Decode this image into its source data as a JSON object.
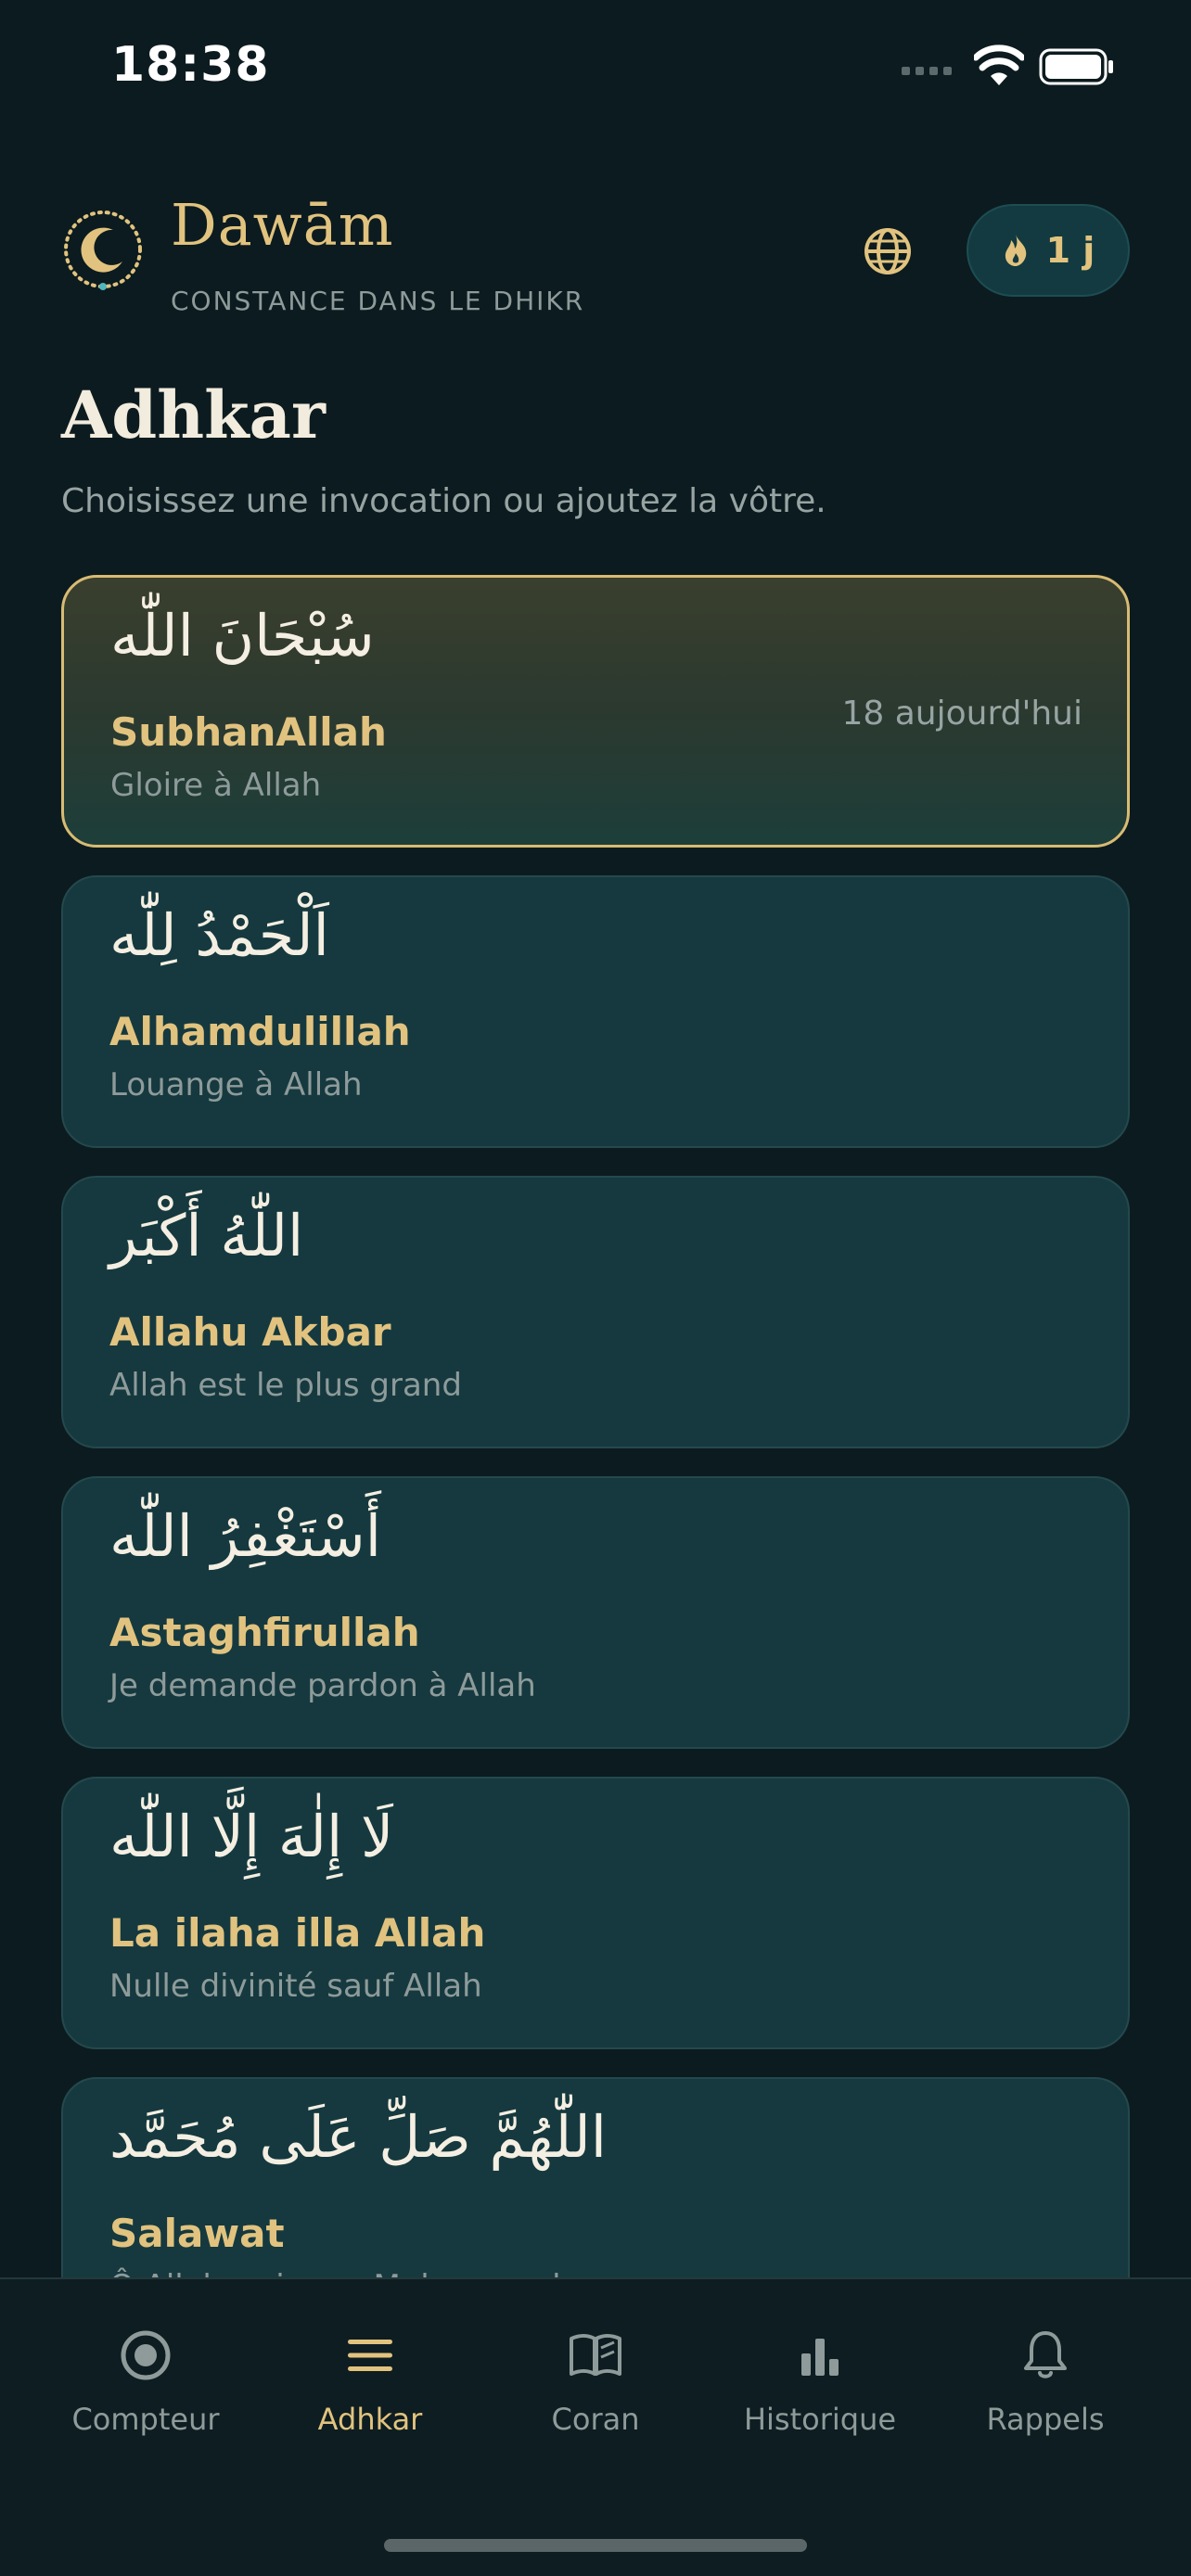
{
  "status_bar": {
    "time": "18:38"
  },
  "header": {
    "app_name": "Dawām",
    "tagline": "CONSTANCE DANS LE DHIKR",
    "language_icon": "globe-icon",
    "streak": {
      "icon": "flame-icon",
      "label": "1 j"
    }
  },
  "page": {
    "title": "Adhkar",
    "description": "Choisissez une invocation ou ajoutez la vôtre."
  },
  "adhkar": [
    {
      "arabic": "سُبْحَانَ اللّٰه",
      "name": "SubhanAllah",
      "translation": "Gloire à Allah",
      "count": "18 aujourd'hui",
      "selected": true
    },
    {
      "arabic": "اَلْحَمْدُ لِلّٰه",
      "name": "Alhamdulillah",
      "translation": "Louange à Allah",
      "count": "",
      "selected": false
    },
    {
      "arabic": "اللّٰهُ أَكْبَر",
      "name": "Allahu Akbar",
      "translation": "Allah est le plus grand",
      "count": "",
      "selected": false
    },
    {
      "arabic": "أَسْتَغْفِرُ اللّٰه",
      "name": "Astaghfirullah",
      "translation": "Je demande pardon à Allah",
      "count": "",
      "selected": false
    },
    {
      "arabic": "لَا إِلٰهَ إِلَّا اللّٰه",
      "name": "La ilaha illa Allah",
      "translation": "Nulle divinité sauf Allah",
      "count": "",
      "selected": false
    },
    {
      "arabic": "اللّٰهُمَّ صَلِّ عَلَى مُحَمَّد",
      "name": "Salawat",
      "translation": "Ô Allah, prie sur Muhammad",
      "count": "",
      "selected": false
    }
  ],
  "tabs": [
    {
      "label": "Compteur",
      "icon": "target-icon",
      "active": false
    },
    {
      "label": "Adhkar",
      "icon": "list-icon",
      "active": true
    },
    {
      "label": "Coran",
      "icon": "book-icon",
      "active": false
    },
    {
      "label": "Historique",
      "icon": "bar-chart-icon",
      "active": false
    },
    {
      "label": "Rappels",
      "icon": "bell-icon",
      "active": false
    }
  ],
  "colors": {
    "background": "#0c1b1f",
    "card": "#15393f",
    "accent_gold": "#e1c37f",
    "muted_text": "#8e9b9a"
  }
}
